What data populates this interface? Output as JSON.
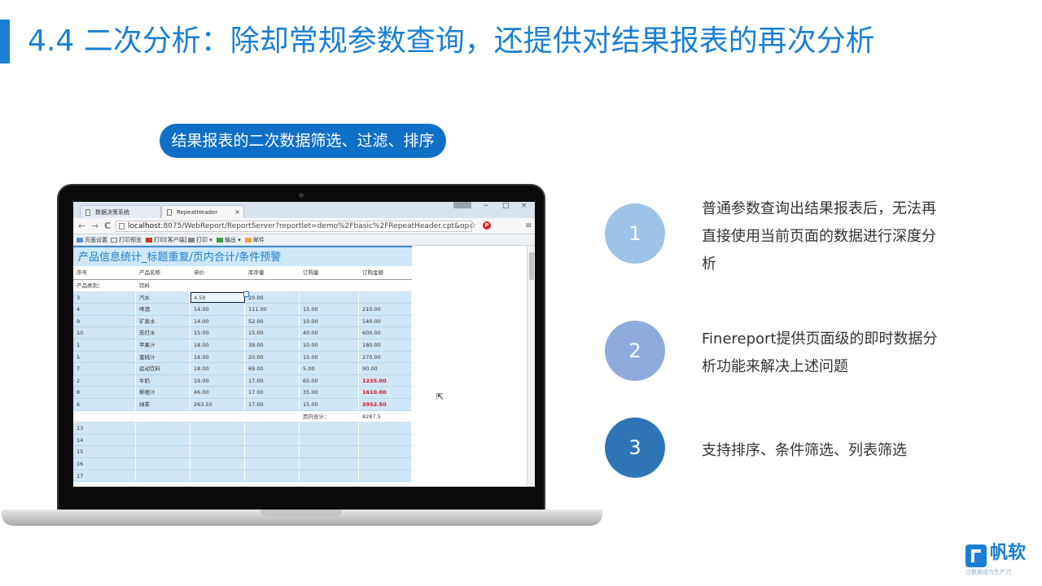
{
  "slide": {
    "title": "4.4 二次分析：除却常规参数查询，还提供对结果报表的再次分析",
    "pill_label": "结果报表的二次数据筛选、过滤、排序"
  },
  "browser": {
    "tabs": [
      "数据决策系统",
      "RepeatHeader"
    ],
    "tab_close": "×",
    "window_controls": [
      "−",
      "□",
      "×"
    ],
    "nav": {
      "back": "←",
      "forward": "→",
      "reload": "C"
    },
    "url_host": "localhost",
    "url_rest": ":8075/WebReport/ReportServer?reportlet=demo%2Fbasic%2FRepeatHeader.cpt&op=view",
    "addr_icons": {
      "star": "☆",
      "menu": "≡"
    },
    "pin_label": "P"
  },
  "toolbar": {
    "items": [
      "页面设置",
      "打印预览",
      "打印[客户端]",
      "打印 ▾",
      "输出 ▾",
      "邮件"
    ]
  },
  "report": {
    "title": "产品信息统计_标题重复/页内合计/条件预警",
    "headers": [
      "序号",
      "产品名称",
      "单价",
      "库存量",
      "订购量",
      "订购金额"
    ],
    "category_label": "产品类别：",
    "category_value": "饮料",
    "rows": [
      [
        "3",
        "汽水",
        "4.50",
        "20.00",
        "",
        ""
      ],
      [
        "4",
        "啤酒",
        "14.00",
        "111.00",
        "15.00",
        "210.00"
      ],
      [
        "9",
        "矿泉水",
        "14.00",
        "52.00",
        "10.00",
        "140.00"
      ],
      [
        "10",
        "苏打水",
        "15.00",
        "15.00",
        "40.00",
        "600.00"
      ],
      [
        "1",
        "苹果汁",
        "18.00",
        "39.00",
        "10.00",
        "180.00"
      ],
      [
        "5",
        "蜜桃汁",
        "18.00",
        "20.00",
        "15.00",
        "270.00"
      ],
      [
        "7",
        "运动饮料",
        "18.00",
        "69.00",
        "5.00",
        "90.00"
      ],
      [
        "2",
        "牛奶",
        "19.00",
        "17.00",
        "65.00",
        "1235.00"
      ],
      [
        "8",
        "柳橙汁",
        "46.00",
        "17.00",
        "35.00",
        "1610.00"
      ],
      [
        "6",
        "绿茶",
        "263.50",
        "17.00",
        "15.00",
        "3952.50"
      ]
    ],
    "warn_rows": [
      7,
      8,
      9
    ],
    "subtotal_label": "页内合计：",
    "subtotal_value": "8287.5",
    "extra_rows": [
      "13",
      "14",
      "15",
      "16",
      "17"
    ],
    "cursor": "⇱"
  },
  "points": [
    {
      "number": "1",
      "text": "普通参数查询出结果报表后，无法再直接使用当前页面的数据进行深度分析",
      "color": "#9dc3e6"
    },
    {
      "number": "2",
      "text": "Finereport提供页面级的即时数据分析功能来解决上述问题",
      "color": "#8faadc"
    },
    {
      "number": "3",
      "text": "支持排序、条件筛选、列表筛选",
      "color": "#2e75b6"
    }
  ],
  "brand": {
    "name": "帆软",
    "slogan": "让数据成为生产力"
  }
}
